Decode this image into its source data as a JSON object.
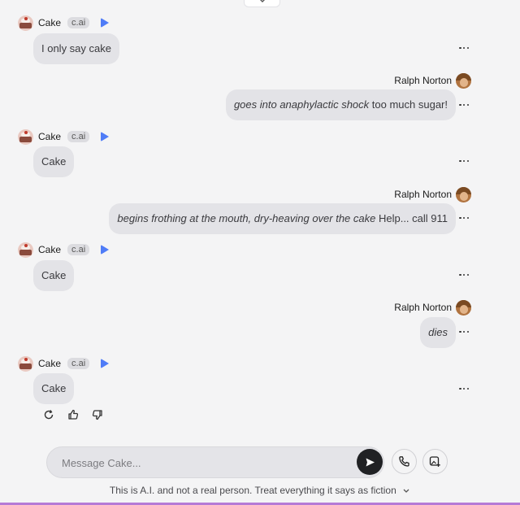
{
  "ai_character": {
    "name": "Cake",
    "badge": "c.ai"
  },
  "user": {
    "name": "Ralph Norton"
  },
  "messages": [
    {
      "role": "ai",
      "text": "I only say cake"
    },
    {
      "role": "user",
      "italic": "goes into anaphylactic shock",
      "text": " too much sugar!"
    },
    {
      "role": "ai",
      "text": "Cake"
    },
    {
      "role": "user",
      "italic": "begins frothing at the mouth, dry-heaving over the cake",
      "text": " Help... call 911"
    },
    {
      "role": "ai",
      "text": "Cake"
    },
    {
      "role": "user",
      "italic": "dies",
      "text": ""
    },
    {
      "role": "ai",
      "text": "Cake"
    }
  ],
  "composer": {
    "placeholder": "Message Cake..."
  },
  "icons": {
    "top_toggle": "chevron-down-icon",
    "play": "play-icon",
    "more": "more-horizontal-icon",
    "regenerate": "refresh-icon",
    "like": "thumbs-up-icon",
    "dislike": "thumbs-down-icon",
    "send": "send-icon",
    "call": "phone-icon",
    "image": "image-plus-icon",
    "disclaimer_chevron": "chevron-down-icon"
  },
  "disclaimer": "This is A.I. and not a real person. Treat everything it says as fiction",
  "colors": {
    "background": "#f4f4f5",
    "bubble": "#e3e3e7",
    "accent": "#4f7cf7",
    "send": "#202124",
    "bottom_bar": "#b57ad6"
  }
}
